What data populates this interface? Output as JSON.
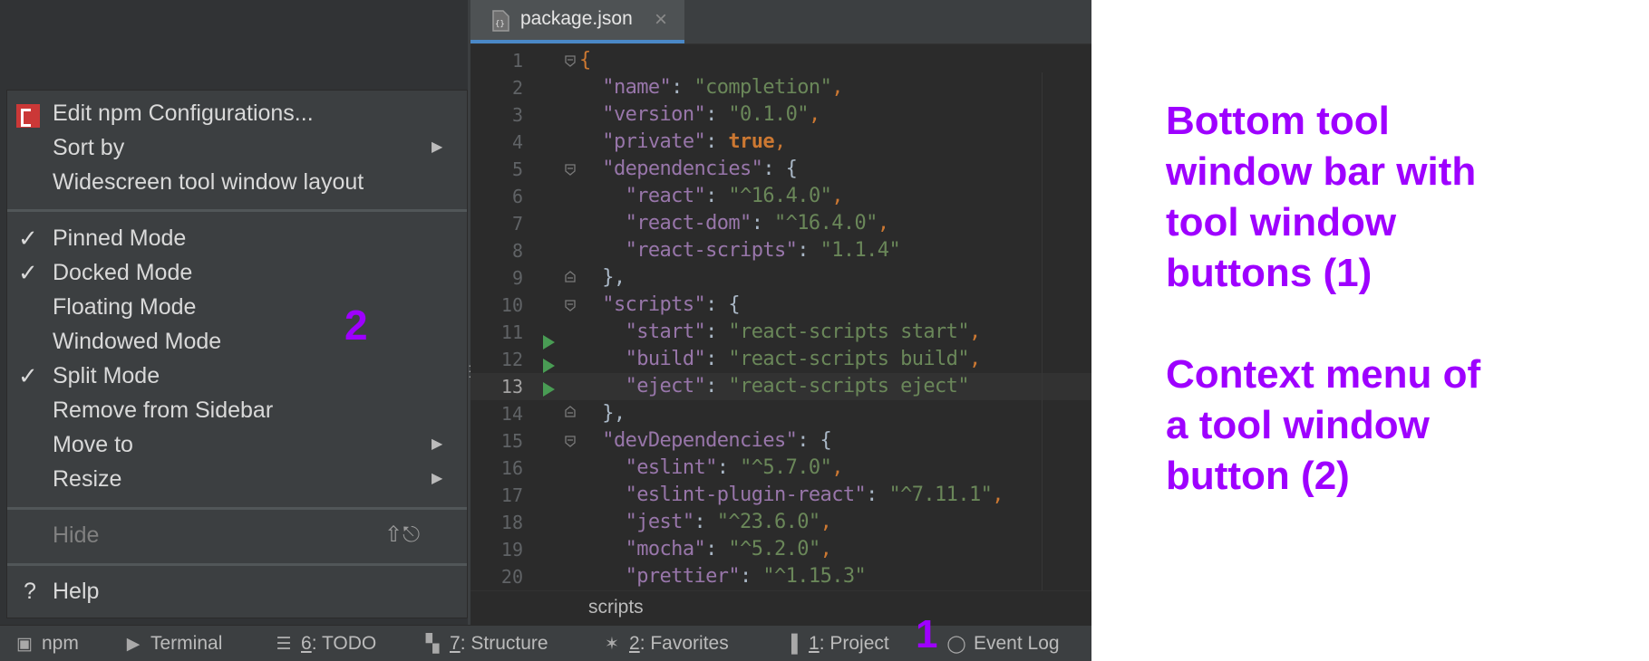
{
  "editor": {
    "tab_label": "package.json",
    "breadcrumb": "scripts",
    "current_line": 13,
    "lines": [
      {
        "n": "1",
        "code": [
          [
            "p",
            "{"
          ]
        ]
      },
      {
        "n": "2",
        "code": [
          [
            "t",
            "  "
          ],
          [
            "k",
            "\"name\""
          ],
          [
            "t",
            ": "
          ],
          [
            "s",
            "\"completion\""
          ],
          [
            "p",
            ","
          ]
        ]
      },
      {
        "n": "3",
        "code": [
          [
            "t",
            "  "
          ],
          [
            "k",
            "\"version\""
          ],
          [
            "t",
            ": "
          ],
          [
            "s",
            "\"0.1.0\""
          ],
          [
            "p",
            ","
          ]
        ]
      },
      {
        "n": "4",
        "code": [
          [
            "t",
            "  "
          ],
          [
            "k",
            "\"private\""
          ],
          [
            "t",
            ": "
          ],
          [
            "b",
            "true"
          ],
          [
            "p",
            ","
          ]
        ]
      },
      {
        "n": "5",
        "code": [
          [
            "t",
            "  "
          ],
          [
            "k",
            "\"dependencies\""
          ],
          [
            "t",
            ": {"
          ]
        ]
      },
      {
        "n": "6",
        "code": [
          [
            "t",
            "    "
          ],
          [
            "k",
            "\"react\""
          ],
          [
            "t",
            ": "
          ],
          [
            "s",
            "\"^16.4.0\""
          ],
          [
            "p",
            ","
          ]
        ]
      },
      {
        "n": "7",
        "code": [
          [
            "t",
            "    "
          ],
          [
            "k",
            "\"react-dom\""
          ],
          [
            "t",
            ": "
          ],
          [
            "s",
            "\"^16.4.0\""
          ],
          [
            "p",
            ","
          ]
        ]
      },
      {
        "n": "8",
        "code": [
          [
            "t",
            "    "
          ],
          [
            "k",
            "\"react-scripts\""
          ],
          [
            "t",
            ": "
          ],
          [
            "s",
            "\"1.1.4\""
          ]
        ]
      },
      {
        "n": "9",
        "code": [
          [
            "t",
            "  },"
          ]
        ]
      },
      {
        "n": "10",
        "code": [
          [
            "t",
            "  "
          ],
          [
            "k",
            "\"scripts\""
          ],
          [
            "t",
            ": {"
          ]
        ]
      },
      {
        "n": "11",
        "code": [
          [
            "t",
            "    "
          ],
          [
            "k",
            "\"start\""
          ],
          [
            "t",
            ": "
          ],
          [
            "s",
            "\"react-scripts start\""
          ],
          [
            "p",
            ","
          ]
        ]
      },
      {
        "n": "12",
        "code": [
          [
            "t",
            "    "
          ],
          [
            "k",
            "\"build\""
          ],
          [
            "t",
            ": "
          ],
          [
            "s",
            "\"react-scripts build\""
          ],
          [
            "p",
            ","
          ]
        ]
      },
      {
        "n": "13",
        "code": [
          [
            "t",
            "    "
          ],
          [
            "k",
            "\"eject\""
          ],
          [
            "t",
            ": "
          ],
          [
            "s",
            "\"react-scripts eject\""
          ]
        ]
      },
      {
        "n": "14",
        "code": [
          [
            "t",
            "  },"
          ]
        ]
      },
      {
        "n": "15",
        "code": [
          [
            "t",
            "  "
          ],
          [
            "k",
            "\"devDependencies\""
          ],
          [
            "t",
            ": {"
          ]
        ]
      },
      {
        "n": "16",
        "code": [
          [
            "t",
            "    "
          ],
          [
            "k",
            "\"eslint\""
          ],
          [
            "t",
            ": "
          ],
          [
            "s",
            "\"^5.7.0\""
          ],
          [
            "p",
            ","
          ]
        ]
      },
      {
        "n": "17",
        "code": [
          [
            "t",
            "    "
          ],
          [
            "k",
            "\"eslint-plugin-react\""
          ],
          [
            "t",
            ": "
          ],
          [
            "s",
            "\"^7.11.1\""
          ],
          [
            "p",
            ","
          ]
        ]
      },
      {
        "n": "18",
        "code": [
          [
            "t",
            "    "
          ],
          [
            "k",
            "\"jest\""
          ],
          [
            "t",
            ": "
          ],
          [
            "s",
            "\"^23.6.0\""
          ],
          [
            "p",
            ","
          ]
        ]
      },
      {
        "n": "19",
        "code": [
          [
            "t",
            "    "
          ],
          [
            "k",
            "\"mocha\""
          ],
          [
            "t",
            ": "
          ],
          [
            "s",
            "\"^5.2.0\""
          ],
          [
            "p",
            ","
          ]
        ]
      },
      {
        "n": "20",
        "code": [
          [
            "t",
            "    "
          ],
          [
            "k",
            "\"prettier\""
          ],
          [
            "t",
            ": "
          ],
          [
            "s",
            "\"^1.15.3\""
          ]
        ]
      }
    ]
  },
  "menu": {
    "edit_npm": "Edit npm Configurations...",
    "sort_by": "Sort by",
    "widescreen": "Widescreen tool window layout",
    "pinned": "Pinned Mode",
    "docked": "Docked Mode",
    "floating": "Floating Mode",
    "windowed": "Windowed Mode",
    "split": "Split Mode",
    "remove": "Remove from Sidebar",
    "move_to": "Move to",
    "resize": "Resize",
    "hide": "Hide",
    "hide_shortcut": "⇧⎋",
    "help": "Help",
    "help_icon": "?",
    "check": "✓",
    "submenu_arrow": "▶"
  },
  "bottom_bar": {
    "npm": "npm",
    "terminal": "Terminal",
    "todo_num": "6",
    "todo": ": TODO",
    "structure_num": "7",
    "structure": ": Structure",
    "favorites_num": "2",
    "favorites": ": Favorites",
    "project_num": "1",
    "project": ": Project",
    "event_log": "Event Log"
  },
  "annotations": {
    "marker_1": "1",
    "marker_2": "2",
    "text_lines_1": [
      "Bottom tool",
      "window bar with",
      "tool window",
      "buttons  (1)"
    ],
    "text_lines_2": [
      "Context menu of",
      "a tool window",
      "button (2)"
    ]
  },
  "colors": {
    "annotation": "#9e00ff",
    "run_arrow": "#499c54",
    "npm_brand": "#cb3837",
    "tab_underline": "#4a88c7"
  }
}
